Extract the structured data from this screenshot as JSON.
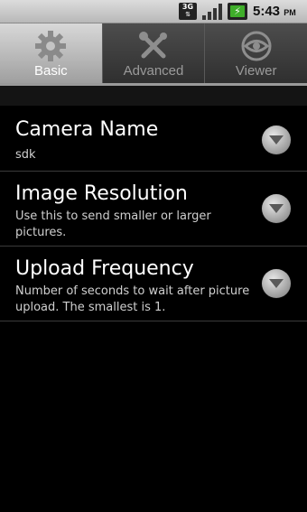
{
  "status_bar": {
    "network": "3G",
    "time": "5:43",
    "ampm": "PM",
    "battery_icon": "battery-charging-icon",
    "signal_icon": "signal-strength-icon"
  },
  "tabs": [
    {
      "label": "Basic",
      "icon": "gear-icon",
      "active": true
    },
    {
      "label": "Advanced",
      "icon": "tools-icon",
      "active": false
    },
    {
      "label": "Viewer",
      "icon": "eye-icon",
      "active": false
    }
  ],
  "settings": [
    {
      "title": "Camera Name",
      "summary": "sdk"
    },
    {
      "title": "Image Resolution",
      "summary": "Use this to send smaller or larger pictures."
    },
    {
      "title": "Upload Frequency",
      "summary": "Number of seconds to wait after picture upload. The smallest is 1."
    }
  ],
  "colors": {
    "background": "#000000",
    "active_tab": "#bdbdbd",
    "battery_green": "#3fae2a"
  }
}
